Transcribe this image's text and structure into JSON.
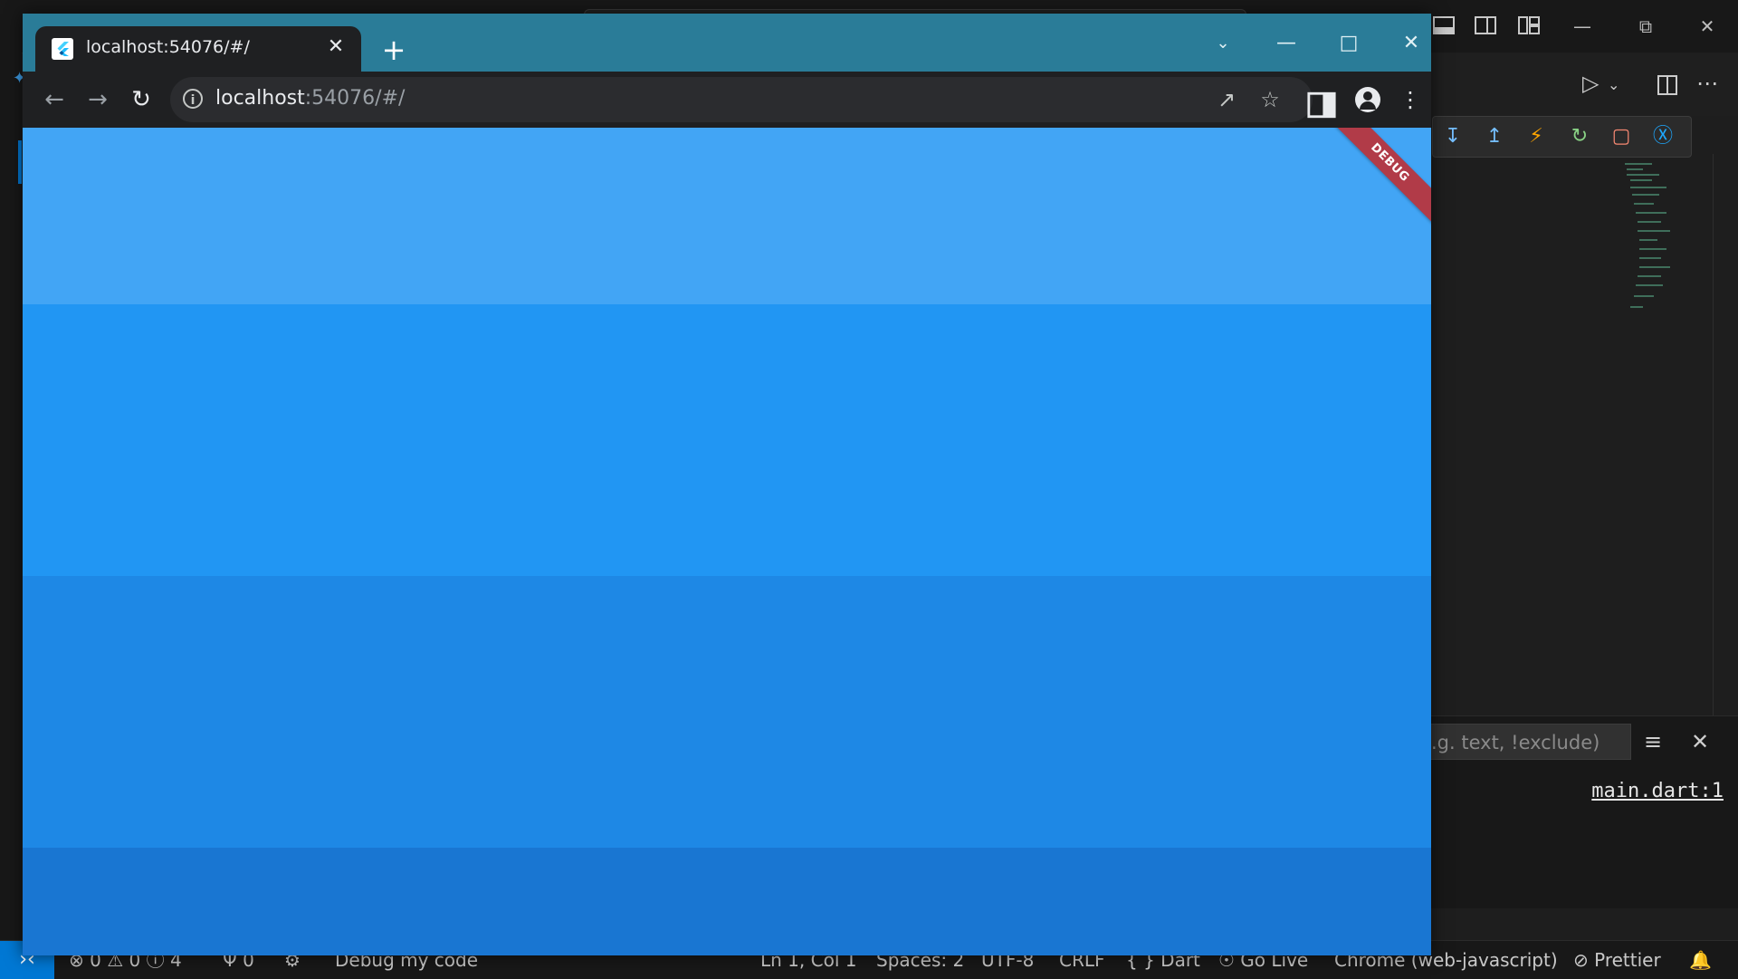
{
  "browser": {
    "tab_title": "localhost:54076/#/",
    "url_host": "localhost",
    "url_rest": ":54076/#/",
    "debug_banner": "DEBUG",
    "bands": [
      {
        "color": "#42a5f5"
      },
      {
        "color": "#2196f3"
      },
      {
        "color": "#1e88e5"
      },
      {
        "color": "#1976d2"
      }
    ]
  },
  "panel": {
    "filter_placeholder": ".g. text, !exclude)",
    "source_link": "main.dart:1"
  },
  "status": {
    "errors": "0",
    "warnings": "0",
    "infos": "4",
    "ports": "0",
    "debug_label": "Debug my code",
    "position": "Ln 1, Col 1",
    "spaces": "Spaces: 2",
    "encoding": "UTF-8",
    "eol": "CRLF",
    "language": "Dart",
    "go_live": "Go Live",
    "device": "Chrome (web-javascript)",
    "prettier": "Prettier"
  },
  "colors": {
    "vscode_bg": "#1e1e1e",
    "statusbar_remote": "#0078d4",
    "chrome_frame": "#2a7c98",
    "chrome_toolbar": "#1f2022",
    "debug_ribbon": "#b13b48"
  },
  "icons": {
    "flutter_favicon": "flutter-icon",
    "close": "close-icon",
    "new_tab": "plus-icon",
    "back": "arrow-left-icon",
    "forward": "arrow-right-icon",
    "reload": "reload-icon",
    "info": "info-icon",
    "share": "share-icon",
    "bookmark": "star-icon",
    "side_panel": "side-panel-icon",
    "profile": "profile-icon",
    "menu": "kebab-menu-icon"
  }
}
